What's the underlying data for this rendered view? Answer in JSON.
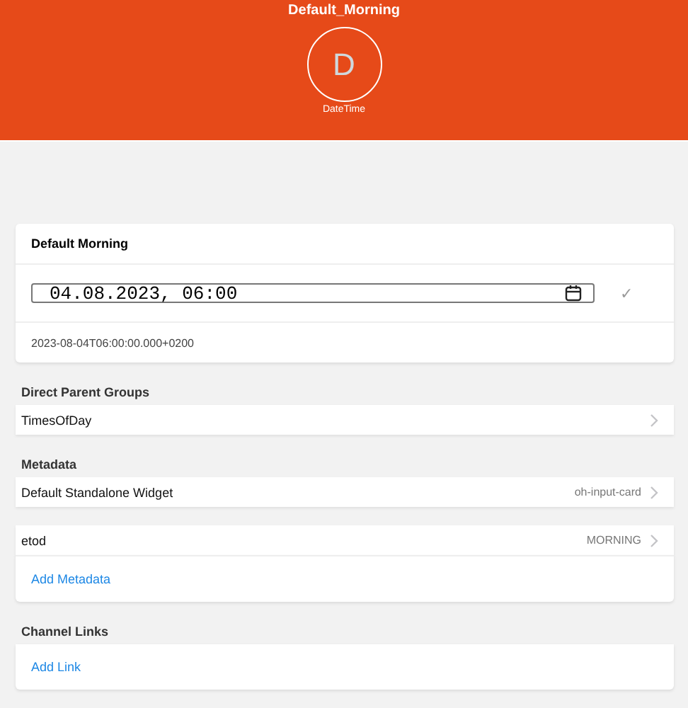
{
  "header": {
    "title": "Default_Morning",
    "avatar_letter": "D",
    "type": "DateTime"
  },
  "state_card": {
    "title": "Default Morning",
    "input_value": "04.08.2023, 06:00",
    "check": "✓",
    "raw_state": "2023-08-04T06:00:00.000+0200"
  },
  "sections": [
    {
      "title": "Direct Parent Groups",
      "items": [
        {
          "kind": "item",
          "label": "TimesOfDay"
        }
      ]
    },
    {
      "title": "Metadata",
      "items": [
        {
          "kind": "item",
          "label": "Default Standalone Widget",
          "after": "oh-input-card"
        },
        {
          "kind": "item",
          "label": "etod",
          "after": "MORNING"
        },
        {
          "kind": "link",
          "label": "Add Metadata"
        }
      ]
    },
    {
      "title": "Channel Links",
      "items": [
        {
          "kind": "link",
          "label": "Add Link"
        }
      ]
    }
  ]
}
